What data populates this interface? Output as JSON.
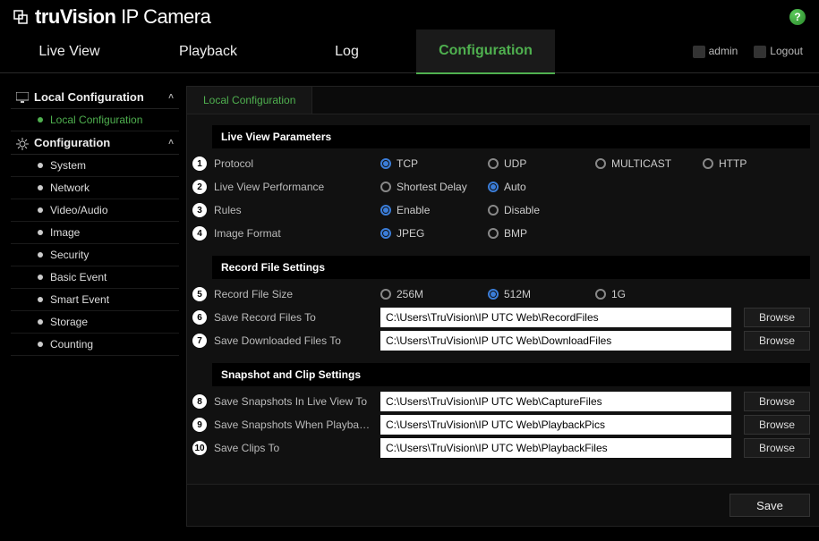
{
  "brand": {
    "name1": "truVision",
    "name2": " IP Camera"
  },
  "help_tooltip": "?",
  "tabs": {
    "live_view": "Live View",
    "playback": "Playback",
    "log": "Log",
    "configuration": "Configuration"
  },
  "user": {
    "name": "admin",
    "logout": "Logout"
  },
  "sidebar": {
    "group1": {
      "title": "Local Configuration",
      "items": [
        "Local Configuration"
      ]
    },
    "group2": {
      "title": "Configuration",
      "items": [
        "System",
        "Network",
        "Video/Audio",
        "Image",
        "Security",
        "Basic Event",
        "Smart Event",
        "Storage",
        "Counting"
      ]
    }
  },
  "subtab": "Local Configuration",
  "sections": {
    "lvp": {
      "title": "Live View Parameters",
      "rows": {
        "protocol": {
          "n": "1",
          "label": "Protocol",
          "opts": [
            "TCP",
            "UDP",
            "MULTICAST",
            "HTTP"
          ],
          "sel": 0
        },
        "perf": {
          "n": "2",
          "label": "Live View Performance",
          "opts": [
            "Shortest Delay",
            "Auto"
          ],
          "sel": 1
        },
        "rules": {
          "n": "3",
          "label": "Rules",
          "opts": [
            "Enable",
            "Disable"
          ],
          "sel": 0
        },
        "imgfmt": {
          "n": "4",
          "label": "Image Format",
          "opts": [
            "JPEG",
            "BMP"
          ],
          "sel": 0
        }
      }
    },
    "rfs": {
      "title": "Record File Settings",
      "rows": {
        "size": {
          "n": "5",
          "label": "Record File Size",
          "opts": [
            "256M",
            "512M",
            "1G"
          ],
          "sel": 1
        },
        "save": {
          "n": "6",
          "label": "Save Record Files To",
          "value": "C:\\Users\\TruVision\\IP UTC Web\\RecordFiles"
        },
        "dl": {
          "n": "7",
          "label": "Save Downloaded Files To",
          "value": "C:\\Users\\TruVision\\IP UTC Web\\DownloadFiles"
        }
      }
    },
    "scs": {
      "title": "Snapshot and Clip Settings",
      "rows": {
        "snaplive": {
          "n": "8",
          "label": "Save Snapshots In Live View To",
          "value": "C:\\Users\\TruVision\\IP UTC Web\\CaptureFiles"
        },
        "snappb": {
          "n": "9",
          "label": "Save Snapshots When Playback ...",
          "value": "C:\\Users\\TruVision\\IP UTC Web\\PlaybackPics"
        },
        "clips": {
          "n": "10",
          "label": "Save Clips To",
          "value": "C:\\Users\\TruVision\\IP UTC Web\\PlaybackFiles"
        }
      }
    }
  },
  "buttons": {
    "browse": "Browse",
    "save": "Save"
  }
}
